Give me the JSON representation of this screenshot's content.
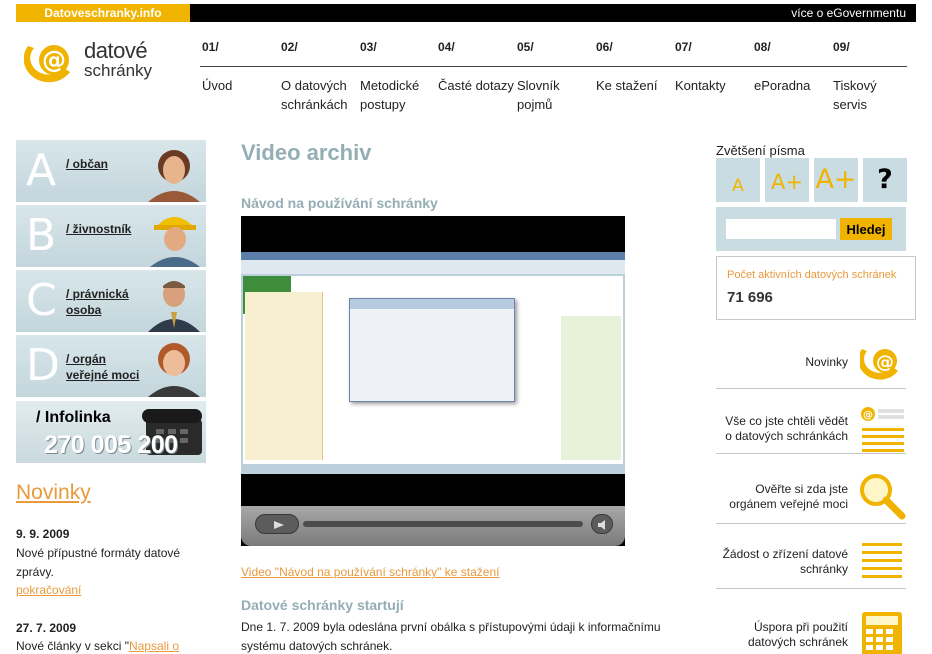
{
  "topbar": {
    "site_label": "Datoveschranky.info",
    "egov_link": "více o eGovernmentu"
  },
  "logo": {
    "line1": "datové",
    "line2": "schránky"
  },
  "nav": [
    {
      "num": "01/",
      "label": "Úvod"
    },
    {
      "num": "02/",
      "label": "O datových schránkách"
    },
    {
      "num": "03/",
      "label": "Metodické postupy"
    },
    {
      "num": "04/",
      "label": "Časté dotazy"
    },
    {
      "num": "05/",
      "label": "Slovník pojmů"
    },
    {
      "num": "06/",
      "label": "Ke stažení"
    },
    {
      "num": "07/",
      "label": "Kontakty"
    },
    {
      "num": "08/",
      "label": "ePoradna"
    },
    {
      "num": "09/",
      "label": "Tiskový servis"
    }
  ],
  "audiences": [
    {
      "letter": "A",
      "label": "/ občan"
    },
    {
      "letter": "B",
      "label": "/ živnostník"
    },
    {
      "letter": "C",
      "label": "/ právnická osoba"
    },
    {
      "letter": "D",
      "label": "/ orgán veřejné moci"
    }
  ],
  "infolinka": {
    "title": "/ Infolinka",
    "phone": "270 005 200"
  },
  "left_news": {
    "title": "Novinky",
    "items": [
      {
        "date": "9. 9. 2009",
        "text": "Nové přípustné formáty datové zprávy.",
        "more": "pokračování"
      },
      {
        "date": "27. 7. 2009",
        "text_before": "Nové články v sekci \"",
        "link": "Napsali o"
      }
    ]
  },
  "main": {
    "title": "Video archiv",
    "video_heading": "Návod na používání schránky",
    "video_download": "Video \"Návod na používání schránky\" ke stažení",
    "section2_heading": "Datové schránky startují",
    "section2_text": "Dne 1. 7. 2009 byla odeslána první obálka s přístupovými údaji k informačnímu systému datových schránek."
  },
  "sidebar_right": {
    "zoom_label": "Zvětšení písma",
    "zoom_buttons": [
      "A",
      "A+",
      "A+",
      "?"
    ],
    "search_placeholder": "",
    "search_button": "Hledej",
    "count_label": "Počet aktivních datových schránek",
    "count_value": "71 696",
    "links": [
      {
        "text": "Novinky",
        "icon": "at-logo-icon"
      },
      {
        "text": "Vše co jste chtěli vědět o datových schránkách",
        "icon": "datove-schranky-logo-icon"
      },
      {
        "text": "Ověřte si zda jste orgánem veřejné moci",
        "icon": "magnifier-icon"
      },
      {
        "text": "Žádost o zřízení datové schránky",
        "icon": "form-lines-icon"
      },
      {
        "text": "Úspora při použití datových schránek",
        "icon": "calculator-icon"
      }
    ]
  },
  "colors": {
    "accent_orange": "#f0b400",
    "link_orange": "#e89a3c",
    "heading_blue": "#94aeb6",
    "panel_blue": "#c8dce2"
  }
}
